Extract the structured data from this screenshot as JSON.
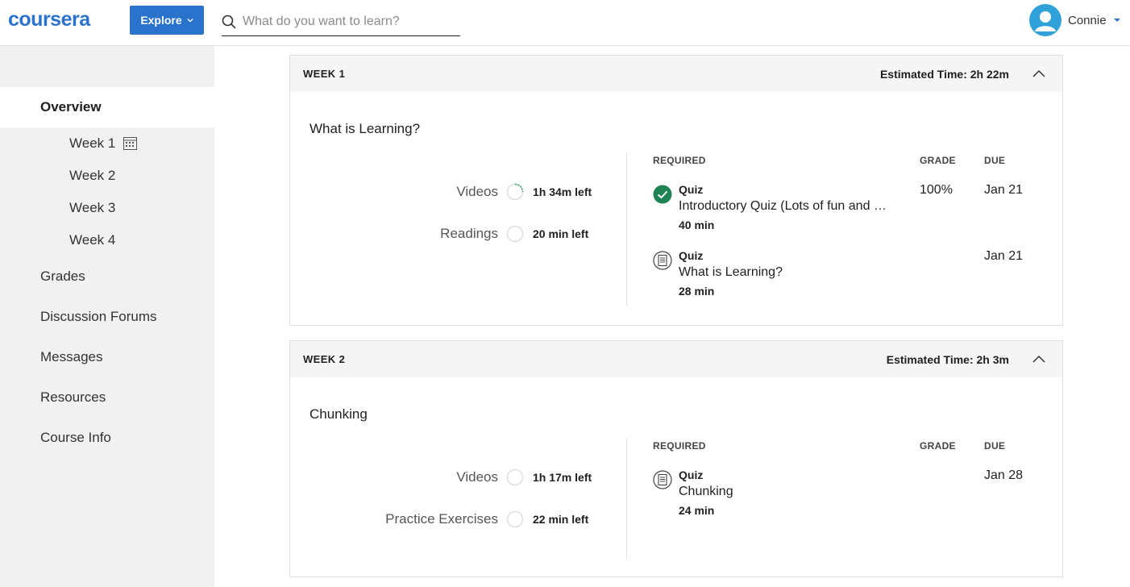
{
  "header": {
    "logo": "coursera",
    "explore_label": "Explore",
    "search_placeholder": "What do you want to learn?",
    "user_name": "Connie"
  },
  "colors": {
    "brand": "#2a73cc",
    "complete": "#1f8354",
    "avatar": "#30a1d9"
  },
  "sidebar": {
    "items": [
      {
        "label": "Overview"
      },
      {
        "label": "Week 1"
      },
      {
        "label": "Week 2"
      },
      {
        "label": "Week 3"
      },
      {
        "label": "Week 4"
      },
      {
        "label": "Grades"
      },
      {
        "label": "Discussion Forums"
      },
      {
        "label": "Messages"
      },
      {
        "label": "Resources"
      },
      {
        "label": "Course Info"
      }
    ]
  },
  "weeks": [
    {
      "label": "WEEK 1",
      "estimated": "Estimated Time: 2h 22m",
      "title": "What is Learning?",
      "progress": [
        {
          "label": "Videos",
          "time": "1h 34m left"
        },
        {
          "label": "Readings",
          "time": "20 min left"
        }
      ],
      "columns": {
        "required": "REQUIRED",
        "grade": "GRADE",
        "due": "DUE"
      },
      "items": [
        {
          "type": "Quiz",
          "name": "Introductory Quiz (Lots of fun and …",
          "duration": "40 min",
          "grade": "100%",
          "due": "Jan 21",
          "icon": "check-circle-icon"
        },
        {
          "type": "Quiz",
          "name": "What is Learning?",
          "duration": "28 min",
          "grade": "",
          "due": "Jan 21",
          "icon": "quiz-document-icon"
        }
      ]
    },
    {
      "label": "WEEK 2",
      "estimated": "Estimated Time: 2h 3m",
      "title": "Chunking",
      "progress": [
        {
          "label": "Videos",
          "time": "1h 17m left"
        },
        {
          "label": "Practice Exercises",
          "time": "22 min left"
        }
      ],
      "columns": {
        "required": "REQUIRED",
        "grade": "GRADE",
        "due": "DUE"
      },
      "items": [
        {
          "type": "Quiz",
          "name": "Chunking",
          "duration": "24 min",
          "grade": "",
          "due": "Jan 28",
          "icon": "quiz-document-icon"
        }
      ]
    }
  ]
}
